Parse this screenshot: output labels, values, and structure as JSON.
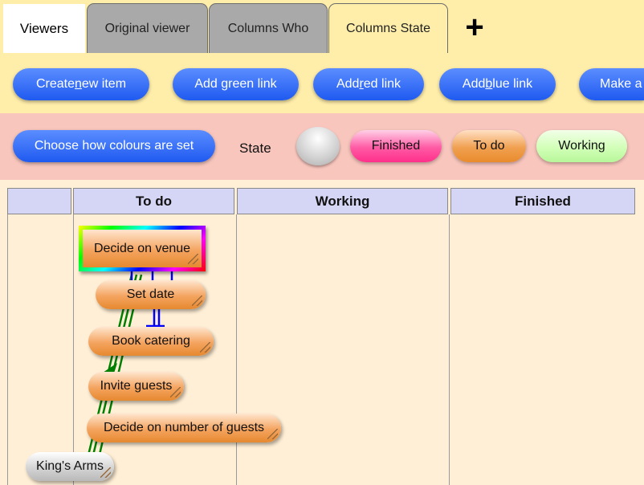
{
  "tabs": [
    {
      "label": "Viewers"
    },
    {
      "label": "Original viewer"
    },
    {
      "label": "Columns Who"
    },
    {
      "label": "Columns State"
    }
  ],
  "toolbar": {
    "create": {
      "before": "Create ",
      "key": "n",
      "after": "ew item"
    },
    "green": {
      "label": "Add green link"
    },
    "red": {
      "before": "Add ",
      "key": "r",
      "after": "ed link"
    },
    "blue": {
      "before": "Add ",
      "key": "b",
      "after": "lue link"
    },
    "make": {
      "label": "Make a"
    }
  },
  "colours": {
    "choose_label": "Choose how colours are set",
    "state_label": "State",
    "states": [
      "Finished",
      "To do",
      "Working"
    ]
  },
  "board": {
    "columns": [
      "",
      "To do",
      "Working",
      "Finished"
    ],
    "cards": [
      "Decide on venue",
      "Set date",
      "Book catering",
      "Invite guests",
      "Decide on number of guests",
      "King's Arms"
    ]
  },
  "colors": {
    "button_blue": "#2f6df5",
    "tab_bar": "#ffeeaa",
    "colour_bar": "#f8c6bd",
    "board_bg": "#ffefd6",
    "header_bg": "#d5d5f5",
    "finished": "#ff4a99",
    "todo": "#f0a050",
    "working": "#c8ffa8",
    "green_link": "#008000",
    "blue_link": "#0000ff"
  }
}
